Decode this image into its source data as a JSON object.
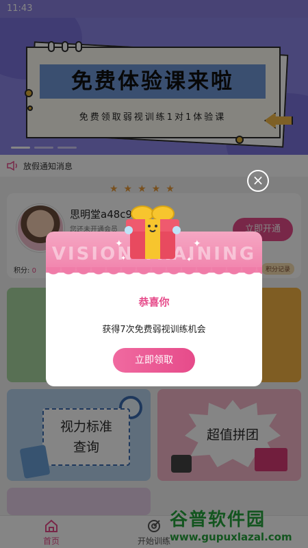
{
  "status_bar": {
    "time": "11:43"
  },
  "banner": {
    "headline": "免费体验课来啦",
    "subline": "免费领取弱视训练1对1体验课"
  },
  "notice": {
    "text": "放假通知消息"
  },
  "member": {
    "username": "思明堂a48c9b",
    "status": "您还未开通会员",
    "open_button": "立即开通",
    "points_label": "积分:",
    "points_value": "0",
    "record_label": "积分记录"
  },
  "tiles": {
    "standard_query": {
      "line1": "视力标准",
      "line2": "查询"
    },
    "group_buy": {
      "label": "超值拼团"
    }
  },
  "bottom_nav": {
    "items": [
      {
        "label": "首页",
        "active": true
      },
      {
        "label": "开始训练",
        "active": false
      }
    ]
  },
  "watermark": {
    "brand": "谷普软件园",
    "url": "www.gupuxlazal.com"
  },
  "dialog": {
    "header_text": "VISION TRAINING",
    "title": "恭喜你",
    "message": "获得7次免费弱视训练机会",
    "claim_button": "立即领取",
    "close_symbol": "×"
  },
  "colors": {
    "accent": "#e64b8a",
    "banner_bg": "#8d86e8",
    "headline_bg": "#6f97d6",
    "watermark": "#25a43c"
  }
}
